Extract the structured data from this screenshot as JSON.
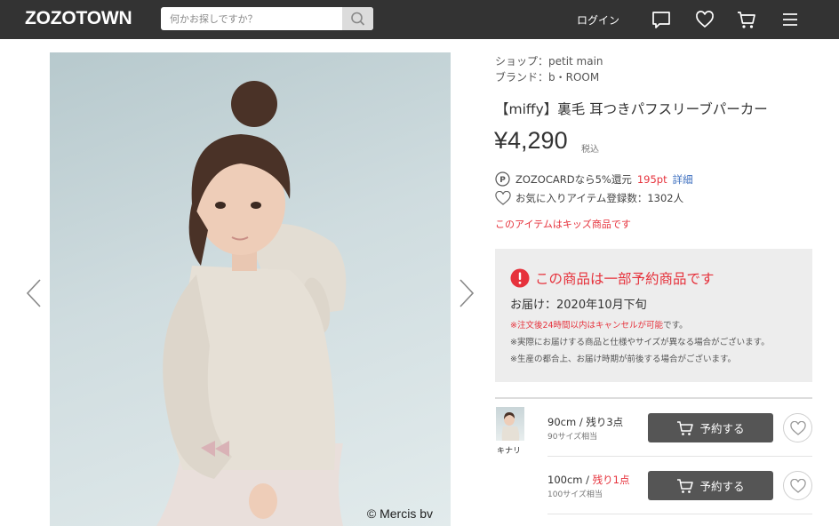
{
  "header": {
    "logo": "ZOZOTOWN",
    "search_placeholder": "何かお探しですか？",
    "login": "ログイン",
    "icons": [
      "search-icon",
      "chat-icon",
      "heart-icon",
      "cart-icon",
      "menu-icon"
    ]
  },
  "product": {
    "shop": "ショップ：petit main",
    "brand": "ブランド：b・ROOM",
    "title": "【miffy】裏毛 耳つきパフスリーブパーカー",
    "price": "¥4,290",
    "tax": "税込",
    "zozocard_text": "ZOZOCARDなら5%還元",
    "points": "195pt",
    "details_link": "詳細",
    "favorites": "お気に入りアイテム登録数：1302人",
    "kids_notice": "このアイテムはキッズ商品です",
    "image_copyright": "© Mercis bv"
  },
  "notice": {
    "headline": "この商品は一部予約商品です",
    "delivery": "お届け：2020年10月下旬",
    "note1_red": "※注文後24時間以内はキャンセルが可能",
    "note1_rest": "です。",
    "note2": "※実際にお届けする商品と仕様やサイズが異なる場合がございます。",
    "note3": "※生産の都合上、お届け時期が前後する場合がございます。"
  },
  "variants": {
    "color_label": "キナリ",
    "sizes": [
      {
        "size": "90cm / ",
        "stock": "残り3点",
        "sub": "90サイズ相当",
        "button": "予約する"
      },
      {
        "size": "100cm / ",
        "stock": "残り1点",
        "sub": "100サイズ相当",
        "button": "予約する"
      }
    ]
  },
  "colors": {
    "header_bg": "#333333",
    "accent_red": "#e6323c",
    "link_blue": "#3d6fbf",
    "button_bg": "#555555"
  }
}
